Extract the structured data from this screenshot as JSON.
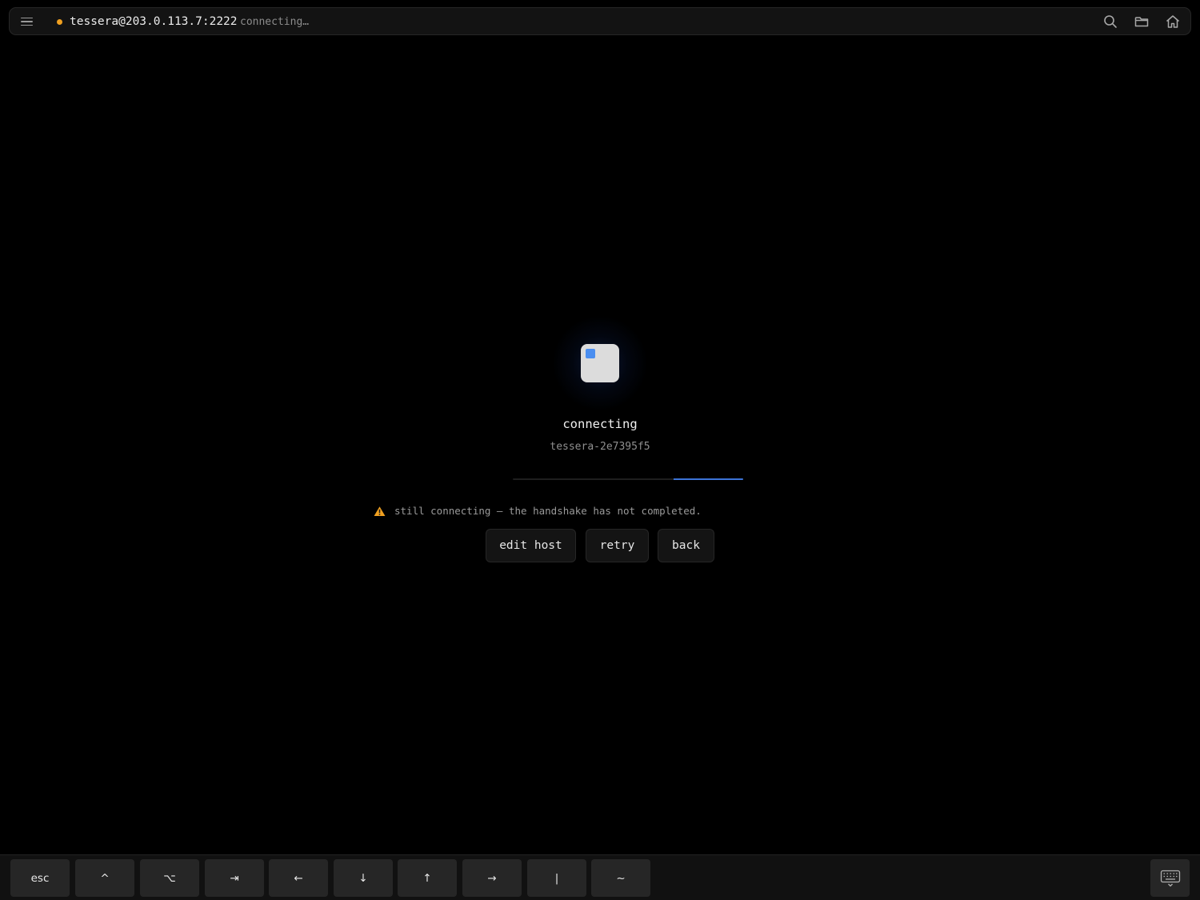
{
  "topbar": {
    "host": "tessera@203.0.113.7:2222",
    "status": "connecting…",
    "status_dot_color": "#f0a020",
    "icons": [
      "menu-icon",
      "search-icon",
      "folder-icon",
      "home-icon"
    ]
  },
  "connection": {
    "title": "connecting",
    "session_id": "tessera-2e7395f5",
    "progress_color": "#3c74d8",
    "warning": "still connecting — the handshake has not completed.",
    "warning_color": "#f0a020"
  },
  "actions": {
    "edit_host": "edit host",
    "retry": "retry",
    "back": "back"
  },
  "keys": {
    "esc": "esc",
    "ctrl": "^",
    "alt": "⌥",
    "tab": "⇥",
    "left": "←",
    "down": "↓",
    "up": "↑",
    "right": "→",
    "pipe": "|",
    "tilde": "~"
  },
  "accent_color": "#4a8ef0"
}
